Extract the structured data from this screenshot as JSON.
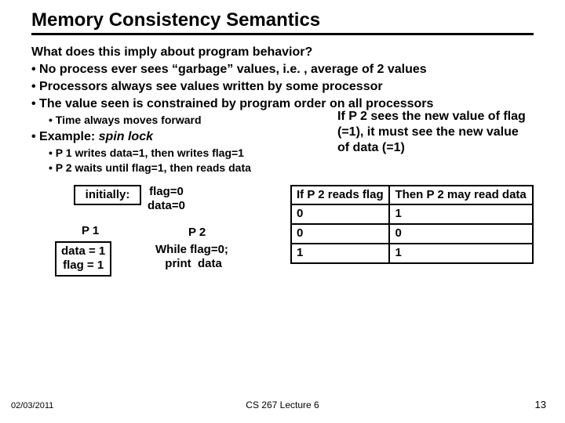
{
  "title": "Memory Consistency Semantics",
  "lead": "What does this imply about program behavior?",
  "bullets": [
    "No process ever sees “garbage” values, i.e. , average of 2 values",
    "Processors always see values written by some processor",
    "The value seen is constrained by program order on all processors"
  ],
  "sub_time": "Time always moves forward",
  "example_label": "Example: ",
  "example_em": "spin lock",
  "sub_ex1": "P 1 writes data=1, then writes flag=1",
  "sub_ex2": "P 2 waits until flag=1, then reads data",
  "side_note": "If P 2 sees the new value of flag (=1), it must see the new value of data (=1)",
  "diagram": {
    "initially_label": "initially:",
    "initially_vals": "flag=0\ndata=0",
    "p1": "P 1",
    "p2": "P 2",
    "p1_body": "data = 1\nflag = 1",
    "p2_body": "While flag=0;\n print  data"
  },
  "table": {
    "h1": "If P 2 reads flag",
    "h2": "Then P 2 may read data",
    "rows": [
      [
        "0",
        "1"
      ],
      [
        "0",
        "0"
      ],
      [
        "1",
        "1"
      ]
    ]
  },
  "footer": {
    "date": "02/03/2011",
    "center": "CS 267 Lecture 6",
    "page": "13"
  }
}
